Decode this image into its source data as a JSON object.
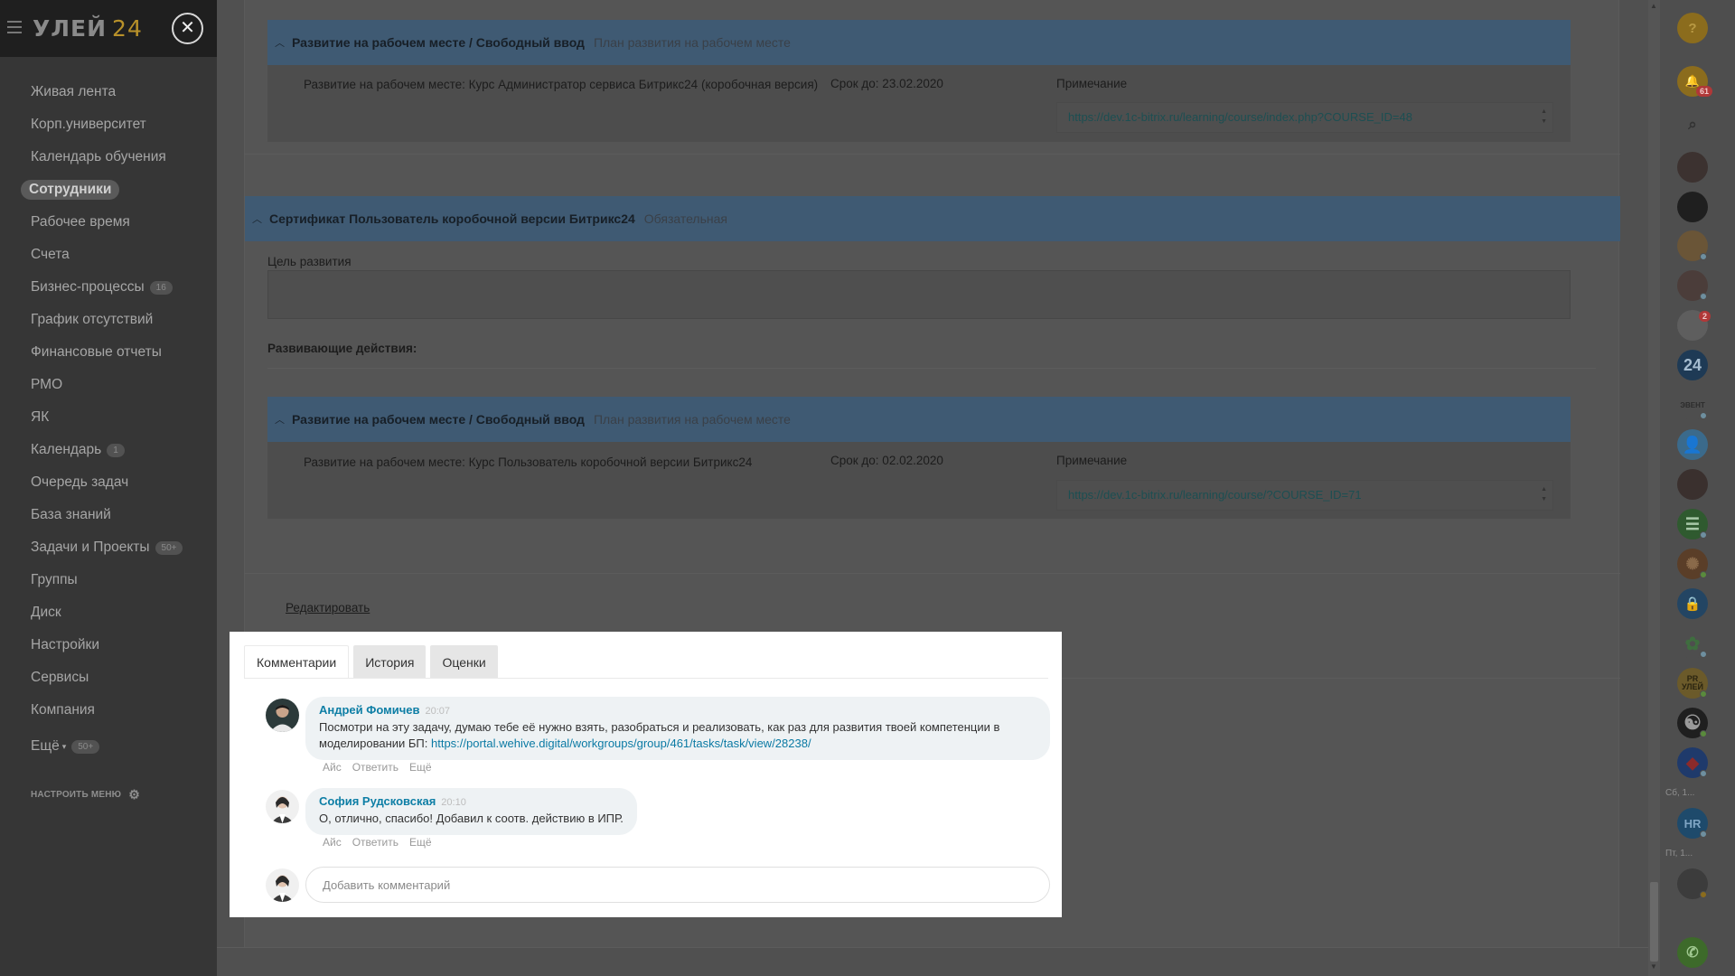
{
  "sidebar": {
    "logo_text": "УЛЕЙ",
    "logo_num": "24",
    "items": [
      {
        "label": "Живая лента",
        "counter": ""
      },
      {
        "label": "Корп.университет",
        "counter": ""
      },
      {
        "label": "Календарь обучения",
        "counter": ""
      },
      {
        "label": "Сотрудники",
        "counter": ""
      },
      {
        "label": "Рабочее время",
        "counter": ""
      },
      {
        "label": "Счета",
        "counter": ""
      },
      {
        "label": "Бизнес-процессы",
        "counter": "16"
      },
      {
        "label": "График отсутствий",
        "counter": ""
      },
      {
        "label": "Финансовые отчеты",
        "counter": ""
      },
      {
        "label": "РМО",
        "counter": ""
      },
      {
        "label": "ЯК",
        "counter": ""
      },
      {
        "label": "Календарь",
        "counter": "1"
      },
      {
        "label": "Очередь задач",
        "counter": ""
      },
      {
        "label": "База знаний",
        "counter": ""
      },
      {
        "label": "Задачи и Проекты",
        "counter": "50+"
      },
      {
        "label": "Группы",
        "counter": ""
      },
      {
        "label": "Диск",
        "counter": ""
      },
      {
        "label": "Настройки",
        "counter": ""
      },
      {
        "label": "Сервисы",
        "counter": ""
      },
      {
        "label": "Компания",
        "counter": ""
      }
    ],
    "more_label": "Ещё",
    "more_counter": "50+",
    "configure_label": "НАСТРОИТЬ МЕНЮ"
  },
  "main": {
    "block1": {
      "title": "Развитие на рабочем месте / Свободный ввод",
      "subtitle": "План развития на рабочем месте",
      "action_text": "Развитие на рабочем месте: Курс Администратор сервиса Битрикс24 (коробочная версия)",
      "deadline": "Срок до: 23.02.2020",
      "note_label": "Примечание",
      "note_value": "https://dev.1c-bitrix.ru/learning/course/index.php?COURSE_ID=48"
    },
    "cert": {
      "title": "Сертификат Пользователь коробочной версии Битрикс24",
      "subtitle": "Обязательная",
      "goal_label": "Цель развития",
      "actions_label": "Развивающие действия:"
    },
    "block2": {
      "title": "Развитие на рабочем месте / Свободный ввод",
      "subtitle": "План развития на рабочем месте",
      "action_text": "Развитие на рабочем месте: Курс Пользователь коробочной версии Битрикс24",
      "deadline": "Срок до: 02.02.2020",
      "note_label": "Примечание",
      "note_value": "https://dev.1c-bitrix.ru/learning/course/?COURSE_ID=71"
    },
    "edit_link": "Редактировать"
  },
  "popup": {
    "tabs": [
      "Комментарии",
      "История",
      "Оценки"
    ],
    "comments": [
      {
        "author": "Андрей Фомичев",
        "time": "20:07",
        "text": "Посмотри на эту задачу, думаю тебе её нужно взять, разобраться и реализовать, как раз для развития твоей компетенции в моделировании БП:",
        "link": "https://portal.wehive.digital/workgroups/group/461/tasks/task/view/28238/",
        "actions": [
          "Айс",
          "Ответить",
          "Ещё"
        ]
      },
      {
        "author": "София Рудсковская",
        "time": "20:10",
        "text": "О, отлично, спасибо! Добавил к соотв. действию в ИПР.",
        "actions": [
          "Айс",
          "Ответить",
          "Ещё"
        ]
      }
    ],
    "add_comment_placeholder": "Добавить комментарий"
  },
  "rightbar": {
    "help": "?",
    "notif_count": "61",
    "chat_badge": "2",
    "b24_label": "24",
    "hr_label": "HR",
    "pr_label": "PR",
    "pr_sub": "УЛЕЙ",
    "ev_label": "ЭВЕНТ",
    "caption1": "Сб, 1...",
    "caption2": "Пт, 1..."
  },
  "colors": {
    "accent_blue": "#0d7ea5",
    "header_blue": "#3f5a73",
    "overlay": "#4a4a4a"
  }
}
